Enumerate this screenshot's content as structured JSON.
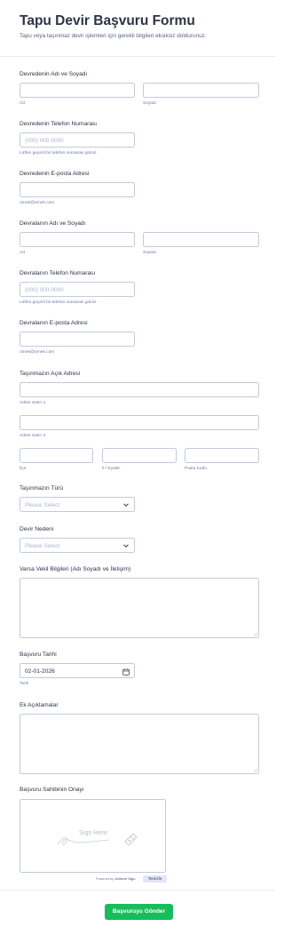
{
  "header": {
    "title": "Tapu Devir Başvuru Formu",
    "subtitle": "Tapu veya taşınmaz devir işlemleri için gerekli bilgileri eksiksiz doldurunuz."
  },
  "transferor_name": {
    "label": "Devredenin Adı ve Soyadı",
    "first_sublabel": "Ad",
    "last_sublabel": "Soyadı"
  },
  "transferor_phone": {
    "label": "Devredenin Telefon Numarası",
    "placeholder": "(000) 000-0000",
    "sublabel": "Lütfen geçerli bir telefon numarası giriniz."
  },
  "transferor_email": {
    "label": "Devredenin E-posta Adresi",
    "sublabel": "ornek@ornek.com"
  },
  "transferee_name": {
    "label": "Devralanın Adı ve Soyadı",
    "first_sublabel": "Ad",
    "last_sublabel": "Soyadı"
  },
  "transferee_phone": {
    "label": "Devralanın Telefon Numarası",
    "placeholder": "(000) 000-0000",
    "sublabel": "Lütfen geçerli bir telefon numarası giriniz."
  },
  "transferee_email": {
    "label": "Devralanın E-posta Adresi",
    "sublabel": "ornek@ornek.com"
  },
  "property_address": {
    "label": "Taşınmazın Açık Adresi",
    "line1_sublabel": "Adres Satırı 1",
    "line2_sublabel": "Adres Satırı 2",
    "city_sublabel": "İlçe",
    "state_sublabel": "İl / Eyalet",
    "postal_sublabel": "Posta Kodu"
  },
  "property_type": {
    "label": "Taşınmazın Türü",
    "selected": "Please Select"
  },
  "transfer_reason": {
    "label": "Devir Nedeni",
    "selected": "Please Select"
  },
  "proxy_info": {
    "label": "Varsa Vekil Bilgileri (Adı Soyadı ve İletişim)"
  },
  "application_date": {
    "label": "Başvuru Tarihi",
    "value": "02-01-2026",
    "sublabel": "Tarih"
  },
  "notes": {
    "label": "Ek Açıklamalar"
  },
  "signature": {
    "label": "Başvuru Sahibinin Onayı",
    "placeholder": "Sign Here",
    "powered_by": "Powered by",
    "brand": "Jotform Sign",
    "clear_label": "Temizle"
  },
  "submit_label": "Başvuruyu Gönder",
  "colors": {
    "accent_green": "#18bd5b",
    "border": "#c3cad8",
    "text": "#2c3345",
    "sublabel": "#6f76a7"
  }
}
